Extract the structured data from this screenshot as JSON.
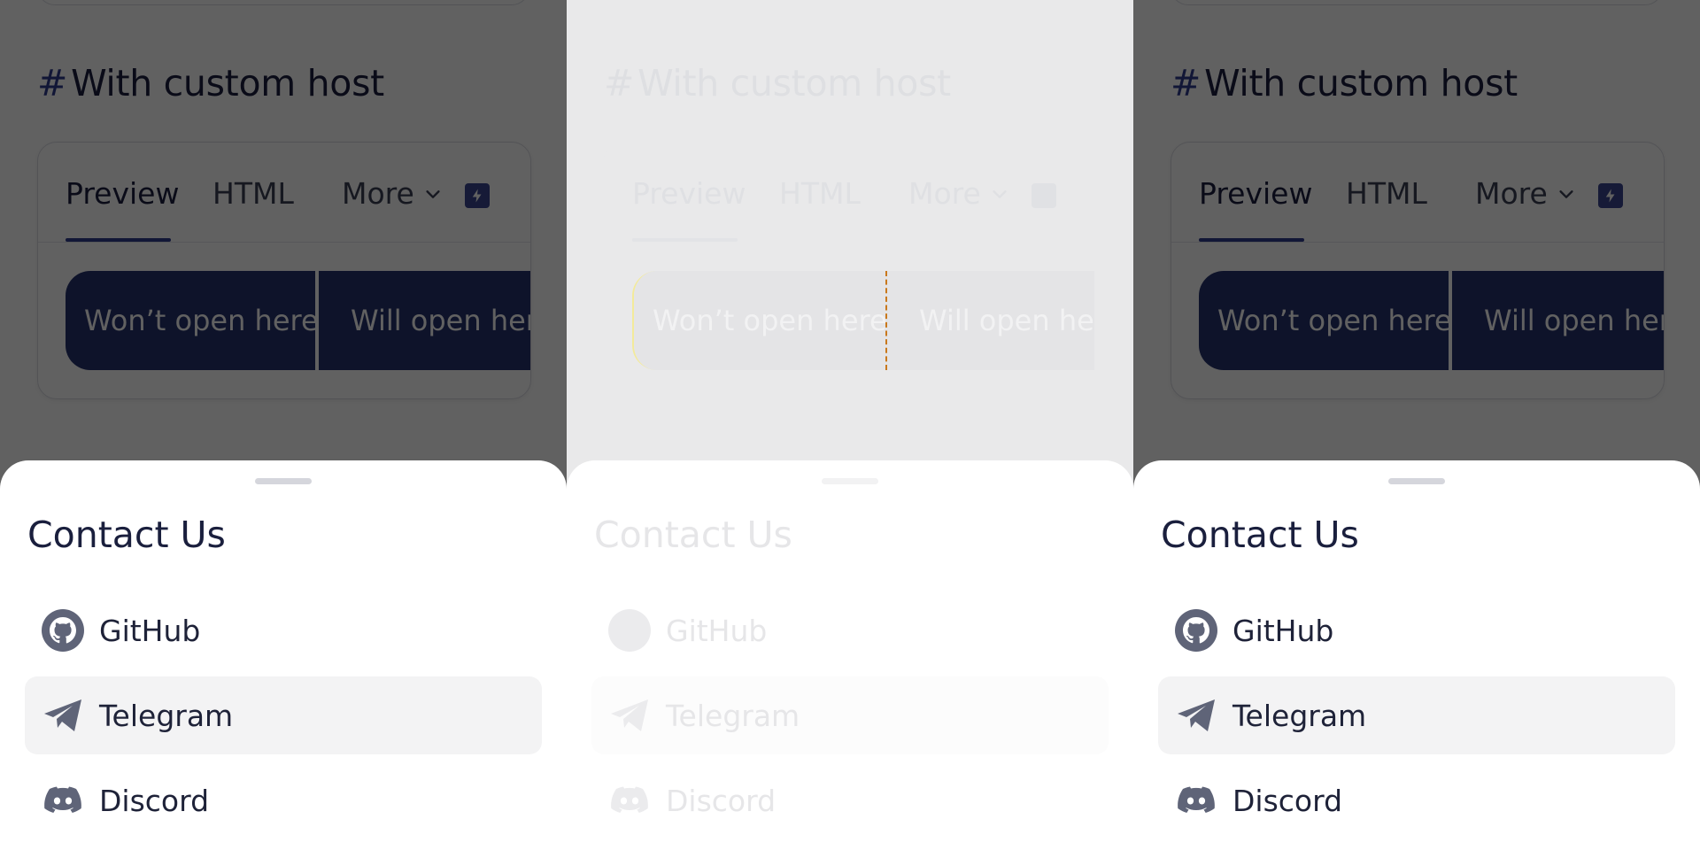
{
  "background_page": {
    "heading_hash": "#",
    "heading": "With custom host",
    "tabs": [
      {
        "label": "Preview",
        "active": true
      },
      {
        "label": "HTML",
        "active": false
      },
      {
        "label": "More",
        "active": false
      }
    ],
    "bolt_icon": "bolt-icon",
    "buttons": [
      {
        "label": "Won’t open here"
      },
      {
        "label": "Will open here"
      }
    ]
  },
  "sheet": {
    "title": "Contact Us",
    "items": [
      {
        "label": "GitHub",
        "icon": "github-icon",
        "highlighted": false
      },
      {
        "label": "Telegram",
        "icon": "telegram-icon",
        "highlighted": true
      },
      {
        "label": "Discord",
        "icon": "discord-icon",
        "highlighted": false
      }
    ]
  },
  "colors": {
    "accent": "#2f3a8f",
    "button_bg": "#26326e",
    "text_dark": "#1a1f3d",
    "icon_gray": "#5f6478",
    "highlight_bg": "#f3f3f4"
  }
}
